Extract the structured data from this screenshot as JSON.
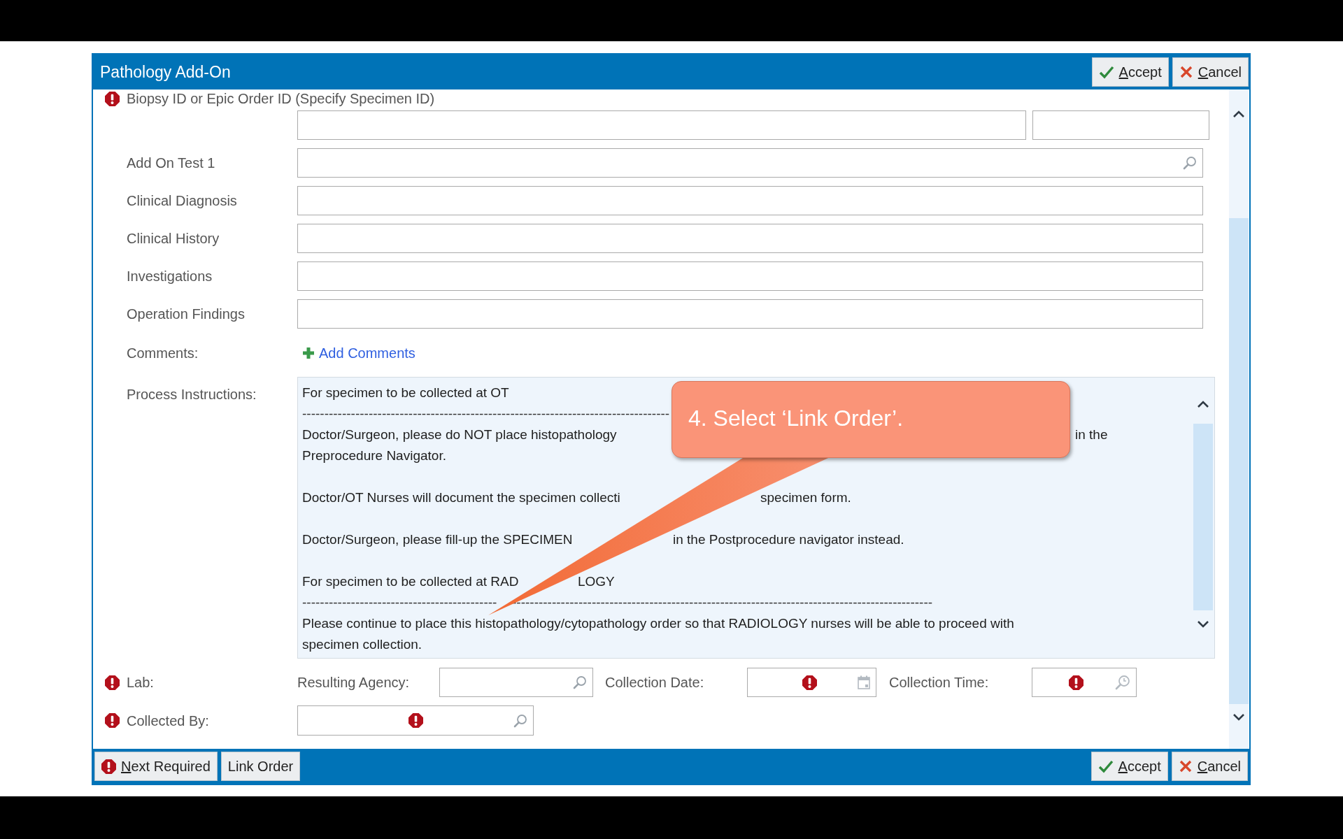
{
  "window": {
    "title": "Pathology Add-On"
  },
  "header_buttons": [
    {
      "kind": "accept",
      "label": "Accept",
      "mnemonic_underlined": true
    },
    {
      "kind": "cancel",
      "label": "Cancel",
      "mnemonic_underlined": true
    }
  ],
  "form": {
    "specimen_id": {
      "label": "Biopsy ID or Epic Order ID (Specify Specimen ID)",
      "required": true
    },
    "fields": [
      {
        "label": "Add On Test 1",
        "kind": "lookup"
      },
      {
        "label": "Clinical Diagnosis",
        "kind": "text"
      },
      {
        "label": "Clinical History",
        "kind": "text"
      },
      {
        "label": "Investigations",
        "kind": "text"
      },
      {
        "label": "Operation Findings",
        "kind": "text"
      }
    ],
    "comments": {
      "label": "Comments:",
      "link": "Add Comments"
    },
    "process_instructions": {
      "label": "Process Instructions:",
      "items": [
        {
          "kind": "heading",
          "lines": [
            [
              "For specimen to be collected at OT"
            ]
          ]
        },
        {
          "kind": "rule",
          "lines": [
            [
              "-----------------------------------------------------------------------------------"
            ]
          ]
        },
        {
          "kind": "paragraph",
          "lines": [
            [
              "Doctor/Surgeon, please do NOT place histopathology",
              "in the"
            ],
            [
              "Preprocedure Navigator."
            ]
          ]
        },
        {
          "kind": "paragraph",
          "lines": [
            [
              "Doctor/OT Nurses will document the specimen collecti",
              "specimen form."
            ]
          ]
        },
        {
          "kind": "paragraph",
          "lines": [
            [
              "Doctor/Surgeon, please fill-up the SPECIMEN",
              "in the Postprocedure navigator instead."
            ]
          ]
        },
        {
          "kind": "heading",
          "lines": [
            [
              "For specimen to be collected at RAD",
              "LOGY"
            ]
          ]
        },
        {
          "kind": "rule",
          "lines": [
            [
              "--------------------------------------------",
              "-----------------------------------------------------------------------------------------------"
            ]
          ]
        },
        {
          "kind": "paragraph",
          "lines": [
            [
              "Please continue to place this histopathology/cytopathology order so that RADIOLOGY nurses will be able to proceed with"
            ],
            [
              "specimen collection."
            ]
          ]
        }
      ]
    },
    "lab": {
      "label": "Lab:",
      "required": true,
      "fields": [
        {
          "label": "Resulting Agency:",
          "kind": "lookup",
          "required": false
        },
        {
          "label": "Collection Date:",
          "kind": "date",
          "required": true
        },
        {
          "label": "Collection Time:",
          "kind": "time",
          "required": true
        }
      ]
    },
    "collected_by": {
      "label": "Collected By:",
      "required": true,
      "field_required": true
    }
  },
  "footer": {
    "left_buttons": [
      {
        "kind": "next_required",
        "label": "Next Required",
        "mnemonic_underlined": true
      },
      {
        "kind": "plain",
        "label": "Link Order",
        "mnemonic_underlined": false
      }
    ],
    "right_buttons": [
      {
        "kind": "accept",
        "label": "Accept",
        "mnemonic_underlined": true
      },
      {
        "kind": "cancel",
        "label": "Cancel",
        "mnemonic_underlined": true
      }
    ]
  },
  "callout": {
    "text": "4. Select ‘Link Order’."
  }
}
